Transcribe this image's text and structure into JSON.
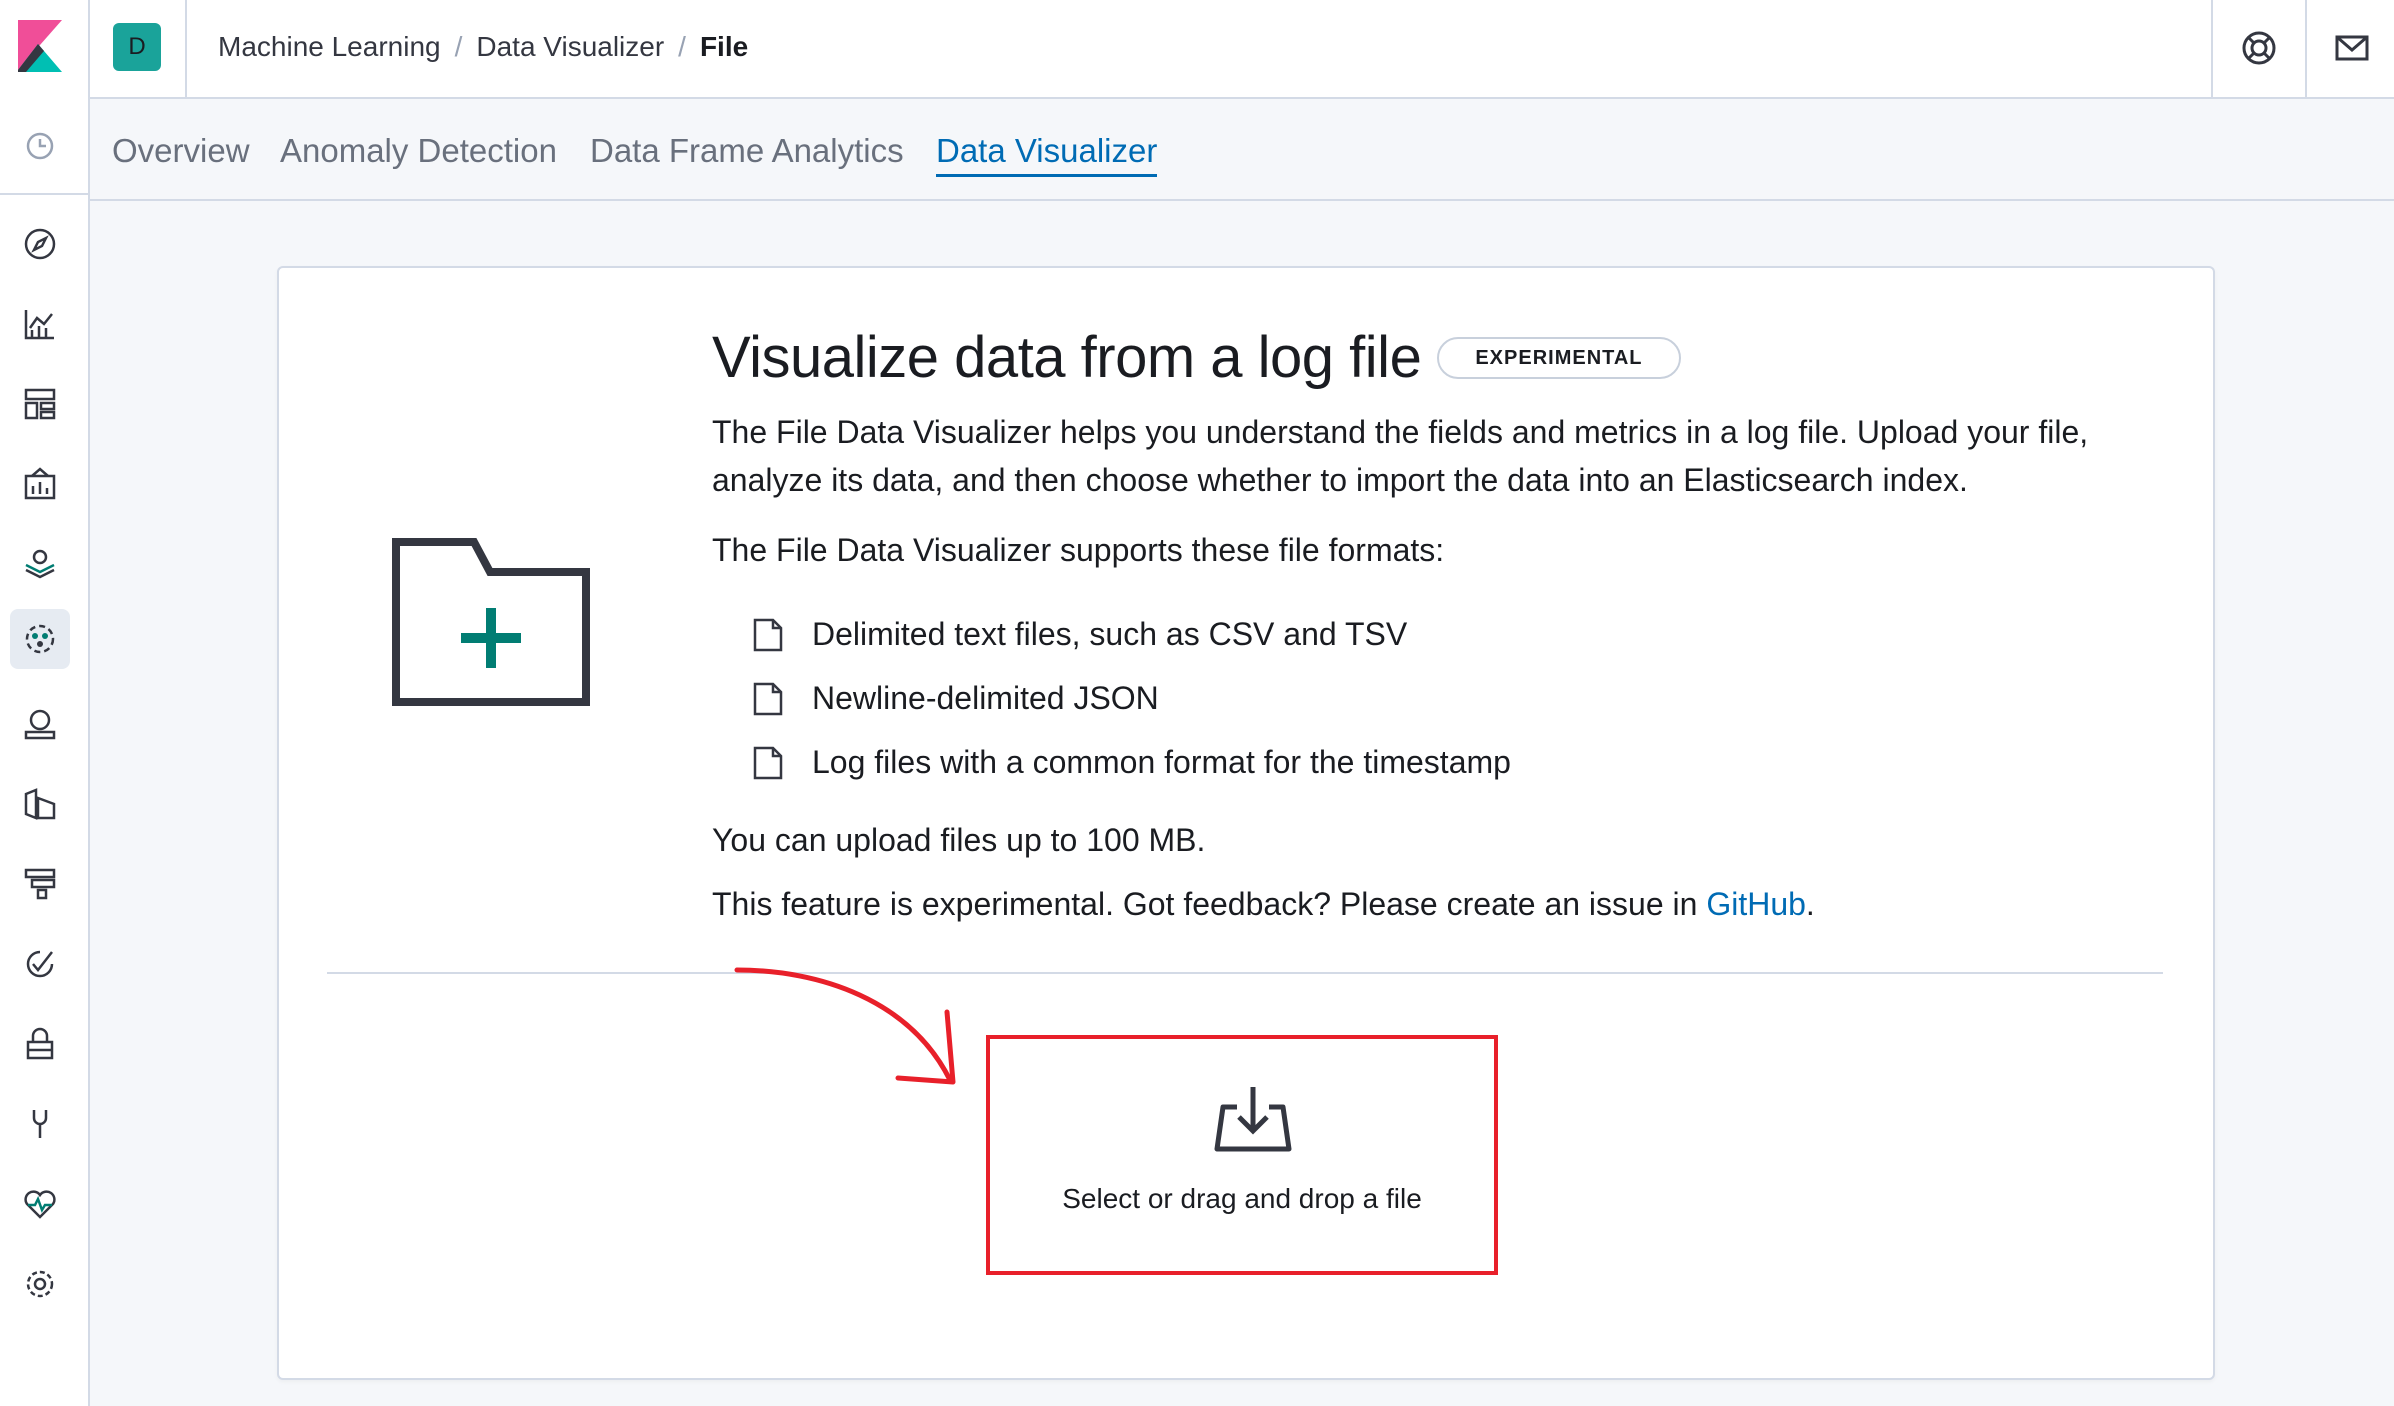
{
  "header": {
    "space_initial": "D",
    "breadcrumbs": [
      {
        "label": "Machine Learning"
      },
      {
        "label": "Data Visualizer"
      },
      {
        "label": "File"
      }
    ],
    "breadcrumb_separator": "/",
    "right_icons": [
      "help-icon",
      "newsfeed-icon"
    ]
  },
  "leftnav": {
    "items": [
      {
        "name": "recently-viewed",
        "icon": "clock-icon"
      },
      {
        "name": "discover",
        "icon": "compass-icon"
      },
      {
        "name": "visualize",
        "icon": "visualize-icon"
      },
      {
        "name": "dashboard",
        "icon": "dashboard-icon"
      },
      {
        "name": "canvas",
        "icon": "canvas-icon"
      },
      {
        "name": "maps",
        "icon": "maps-icon"
      },
      {
        "name": "machine-learning",
        "icon": "ml-icon",
        "active": true
      },
      {
        "name": "infrastructure",
        "icon": "infrastructure-icon"
      },
      {
        "name": "logs",
        "icon": "logs-icon"
      },
      {
        "name": "apm",
        "icon": "apm-icon"
      },
      {
        "name": "uptime",
        "icon": "uptime-icon"
      },
      {
        "name": "siem",
        "icon": "siem-icon"
      },
      {
        "name": "dev-tools",
        "icon": "devtools-icon"
      },
      {
        "name": "monitoring",
        "icon": "monitoring-icon"
      },
      {
        "name": "management",
        "icon": "gear-icon"
      }
    ]
  },
  "tabs": [
    {
      "label": "Overview",
      "active": false
    },
    {
      "label": "Anomaly Detection",
      "active": false
    },
    {
      "label": "Data Frame Analytics",
      "active": false
    },
    {
      "label": "Data Visualizer",
      "active": true
    }
  ],
  "main": {
    "title": "Visualize data from a log file",
    "badge": "EXPERIMENTAL",
    "description": "The File Data Visualizer helps you understand the fields and metrics in a log file. Upload your file, analyze its data, and then choose whether to import the data into an Elasticsearch index.",
    "supports_text": "The File Data Visualizer supports these file formats:",
    "formats": [
      "Delimited text files, such as CSV and TSV",
      "Newline-delimited JSON",
      "Log files with a common format for the timestamp"
    ],
    "upload_limit": "You can upload files up to 100 MB.",
    "feedback_text": "This feature is experimental. Got feedback? Please create an issue in ",
    "feedback_link": "GitHub",
    "feedback_end": ".",
    "dropzone_label": "Select or drag and drop a file"
  },
  "colors": {
    "accent": "#006bb4",
    "space_avatar": "#1aa39a",
    "folder_plus": "#017d73",
    "annotation": "#e8202a"
  }
}
